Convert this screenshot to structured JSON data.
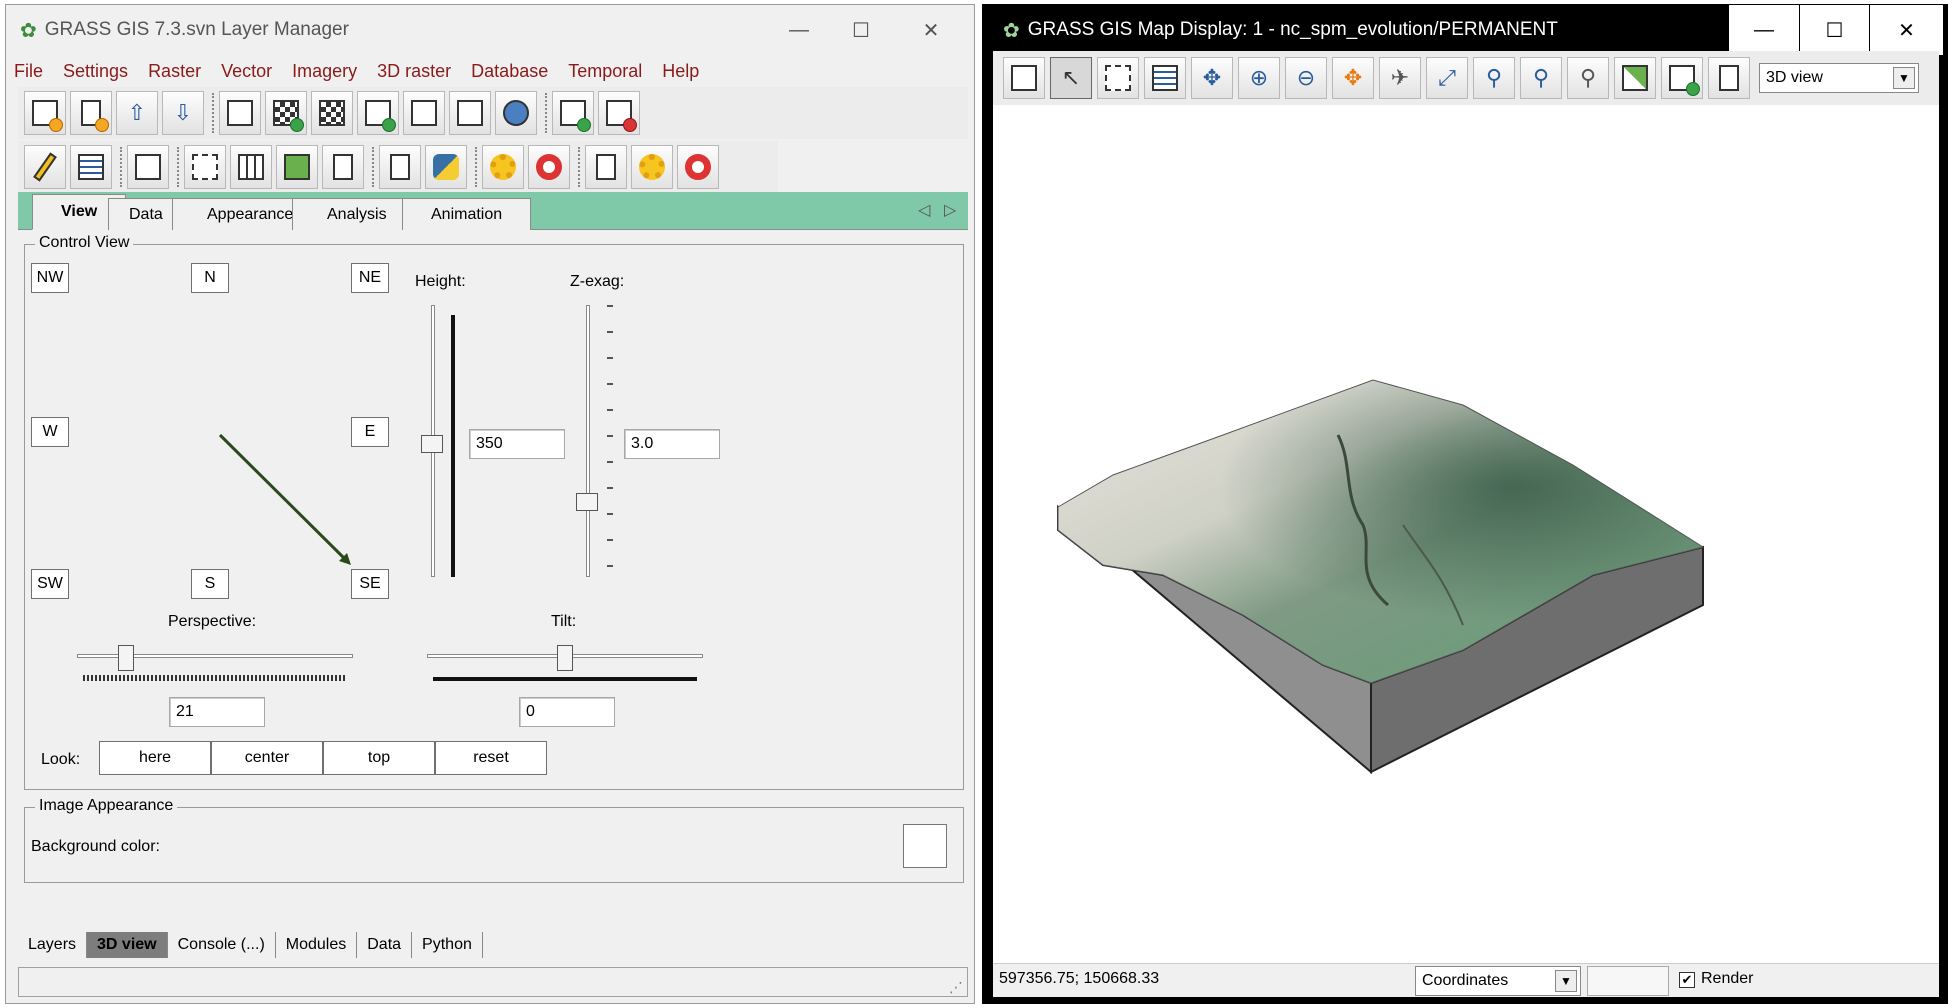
{
  "layer_manager": {
    "title": "GRASS GIS 7.3.svn Layer Manager",
    "window_controls": {
      "minimize": "—",
      "maximize": "☐",
      "close": "✕"
    },
    "menu": [
      "File",
      "Settings",
      "Raster",
      "Vector",
      "Imagery",
      "3D raster",
      "Database",
      "Temporal",
      "Help"
    ],
    "tabs": [
      "View",
      "Data",
      "Appearance",
      "Analysis",
      "Animation"
    ],
    "tab_nav": {
      "prev": "◁",
      "next": "▷"
    },
    "control_view": {
      "legend": "Control View",
      "directions": {
        "nw": "NW",
        "n": "N",
        "ne": "NE",
        "w": "W",
        "e": "E",
        "sw": "SW",
        "s": "S",
        "se": "SE"
      },
      "height_label": "Height:",
      "height_value": "350",
      "zexag_label": "Z-exag:",
      "zexag_value": "3.0",
      "perspective_label": "Perspective:",
      "perspective_value": "21",
      "tilt_label": "Tilt:",
      "tilt_value": "0",
      "look_label": "Look:",
      "look_buttons": [
        "here",
        "center",
        "top",
        "reset"
      ]
    },
    "image_appearance": {
      "legend": "Image Appearance",
      "background_label": "Background color:",
      "background_color": "#ffffff"
    },
    "bottom_tabs": [
      "Layers",
      "3D view",
      "Console (...)",
      "Modules",
      "Data",
      "Python"
    ],
    "active_bottom_tab": "3D view"
  },
  "map_display": {
    "title": "GRASS GIS Map Display: 1 - nc_spm_evolution/PERMANENT",
    "window_controls": {
      "minimize": "—",
      "maximize": "☐",
      "close": "✕"
    },
    "view_mode": "3D view",
    "coordinates": "597356.75; 150668.33",
    "status_mode": "Coordinates",
    "render_label": "Render",
    "render_checked": true
  },
  "colors": {
    "accent_tab": "#7fc8a8",
    "menu_text": "#8a1b1b",
    "terrain_side": "#8f8f8f"
  }
}
